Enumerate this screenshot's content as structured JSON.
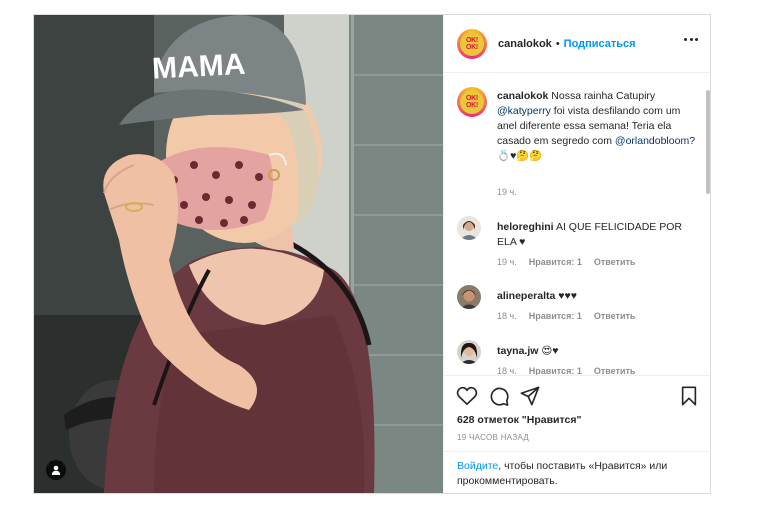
{
  "post": {
    "username": "canalokok",
    "follow_label": "Подписаться",
    "avatar_text": "OK! OK!",
    "caption": {
      "text_before": " Nossa rainha Catupiry ",
      "mention1": "@katyperry",
      "text_middle": " foi vista desfilando com um anel diferente essa semana! Teria ela casado em segredo com ",
      "mention2": "@orlandobloom",
      "text_after": "? 💍♥🤔🤔",
      "time": "19 ч."
    },
    "cap_text": "MAMA",
    "comments": [
      {
        "user": "heloreghini",
        "text": "AI QUE FELICIDADE POR ELA ♥",
        "time": "19 ч.",
        "likes": "Нравится: 1",
        "reply": "Ответить"
      },
      {
        "user": "alineperalta",
        "text": "♥♥♥",
        "time": "18 ч.",
        "likes": "Нравится: 1",
        "reply": "Ответить"
      },
      {
        "user": "tayna.jw",
        "text": "😍♥",
        "time": "18 ч.",
        "likes": "Нравится: 1",
        "reply": "Ответить"
      }
    ],
    "likes_count": "628 отметок \"Нравится\"",
    "age": "19 ЧАСОВ НАЗАД",
    "login_link": "Войдите",
    "login_text": ", чтобы поставить «Нравится» или прокомментировать."
  },
  "icons": [
    "heart-icon",
    "comment-icon",
    "share-icon",
    "bookmark-icon",
    "more-icon",
    "user-tag-icon"
  ]
}
